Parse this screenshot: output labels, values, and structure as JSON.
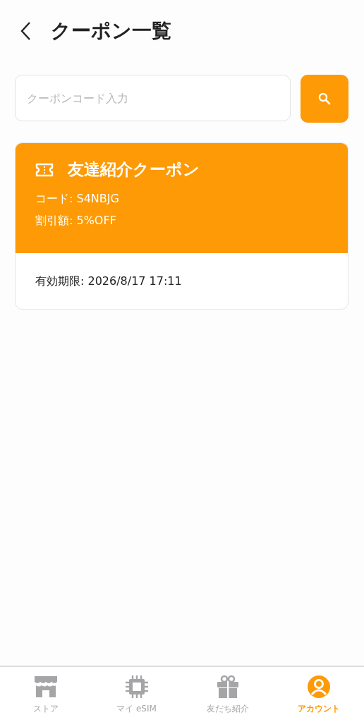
{
  "header": {
    "title": "クーポン一覧"
  },
  "search": {
    "placeholder": "クーポンコード入力"
  },
  "coupons": [
    {
      "title": "友達紹介クーポン",
      "code": "コード: S4NBJG",
      "discount": "割引額: 5%OFF",
      "expiry": "有効期限: 2026/8/17 17:11"
    }
  ],
  "nav": [
    {
      "kind": "store",
      "label": "ストア",
      "selected": false
    },
    {
      "kind": "chip",
      "label": "マイ eSIM",
      "selected": false
    },
    {
      "kind": "gift",
      "label": "友だち紹介",
      "selected": false
    },
    {
      "kind": "account",
      "label": "アカウント",
      "selected": true
    }
  ]
}
